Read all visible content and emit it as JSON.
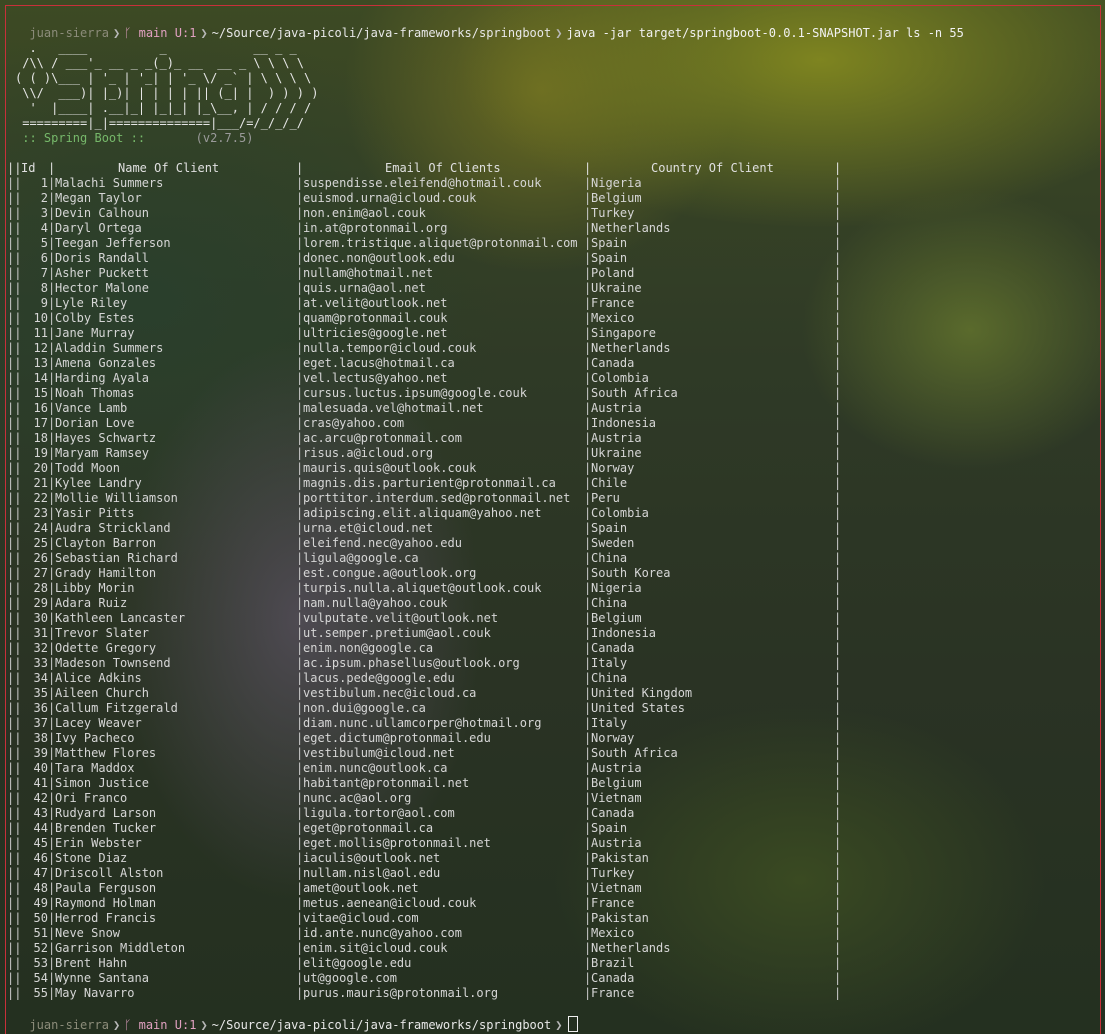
{
  "prompt": {
    "user": "juan-sierra",
    "branch": "main",
    "changes": "U:1",
    "path": "~/Source/java-picoli/java-frameworks/springboot"
  },
  "command": "java -jar target/springboot-0.0.1-SNAPSHOT.jar ls -n 55",
  "banner": {
    "ascii": [
      "  .   ____          _            __ _ _",
      " /\\\\ / ___'_ __ _ _(_)_ __  __ _ \\ \\ \\ \\",
      "( ( )\\___ | '_ | '_| | '_ \\/ _` | \\ \\ \\ \\",
      " \\\\/  ___)| |_)| | | | | || (_| |  ) ) ) )",
      "  '  |____| .__|_| |_|_| |_\\__, | / / / /",
      " =========|_|==============|___/=/_/_/_/"
    ],
    "spring_label": " :: Spring Boot ::",
    "spring_version": "(v2.7.5)"
  },
  "table": {
    "headers": [
      "Id",
      "Name Of Client",
      "Email Of Clients",
      "Country Of Client"
    ],
    "rows": [
      {
        "id": "1",
        "name": "Malachi Summers",
        "email": "suspendisse.eleifend@hotmail.couk",
        "country": "Nigeria"
      },
      {
        "id": "2",
        "name": "Megan Taylor",
        "email": "euismod.urna@icloud.couk",
        "country": "Belgium"
      },
      {
        "id": "3",
        "name": "Devin Calhoun",
        "email": "non.enim@aol.couk",
        "country": "Turkey"
      },
      {
        "id": "4",
        "name": "Daryl Ortega",
        "email": "in.at@protonmail.org",
        "country": "Netherlands"
      },
      {
        "id": "5",
        "name": "Teegan Jefferson",
        "email": "lorem.tristique.aliquet@protonmail.com",
        "country": "Spain"
      },
      {
        "id": "6",
        "name": "Doris Randall",
        "email": "donec.non@outlook.edu",
        "country": "Spain"
      },
      {
        "id": "7",
        "name": "Asher Puckett",
        "email": "nullam@hotmail.net",
        "country": "Poland"
      },
      {
        "id": "8",
        "name": "Hector Malone",
        "email": "quis.urna@aol.net",
        "country": "Ukraine"
      },
      {
        "id": "9",
        "name": "Lyle Riley",
        "email": "at.velit@outlook.net",
        "country": "France"
      },
      {
        "id": "10",
        "name": "Colby Estes",
        "email": "quam@protonmail.couk",
        "country": "Mexico"
      },
      {
        "id": "11",
        "name": "Jane Murray",
        "email": "ultricies@google.net",
        "country": "Singapore"
      },
      {
        "id": "12",
        "name": "Aladdin Summers",
        "email": "nulla.tempor@icloud.couk",
        "country": "Netherlands"
      },
      {
        "id": "13",
        "name": "Amena Gonzales",
        "email": "eget.lacus@hotmail.ca",
        "country": "Canada"
      },
      {
        "id": "14",
        "name": "Harding Ayala",
        "email": "vel.lectus@yahoo.net",
        "country": "Colombia"
      },
      {
        "id": "15",
        "name": "Noah Thomas",
        "email": "cursus.luctus.ipsum@google.couk",
        "country": "South Africa"
      },
      {
        "id": "16",
        "name": "Vance Lamb",
        "email": "malesuada.vel@hotmail.net",
        "country": "Austria"
      },
      {
        "id": "17",
        "name": "Dorian Love",
        "email": "cras@yahoo.com",
        "country": "Indonesia"
      },
      {
        "id": "18",
        "name": "Hayes Schwartz",
        "email": "ac.arcu@protonmail.com",
        "country": "Austria"
      },
      {
        "id": "19",
        "name": "Maryam Ramsey",
        "email": "risus.a@icloud.org",
        "country": "Ukraine"
      },
      {
        "id": "20",
        "name": "Todd Moon",
        "email": "mauris.quis@outlook.couk",
        "country": "Norway"
      },
      {
        "id": "21",
        "name": "Kylee Landry",
        "email": "magnis.dis.parturient@protonmail.ca",
        "country": "Chile"
      },
      {
        "id": "22",
        "name": "Mollie Williamson",
        "email": "porttitor.interdum.sed@protonmail.net",
        "country": "Peru"
      },
      {
        "id": "23",
        "name": "Yasir Pitts",
        "email": "adipiscing.elit.aliquam@yahoo.net",
        "country": "Colombia"
      },
      {
        "id": "24",
        "name": "Audra Strickland",
        "email": "urna.et@icloud.net",
        "country": "Spain"
      },
      {
        "id": "25",
        "name": "Clayton Barron",
        "email": "eleifend.nec@yahoo.edu",
        "country": "Sweden"
      },
      {
        "id": "26",
        "name": "Sebastian Richard",
        "email": "ligula@google.ca",
        "country": "China"
      },
      {
        "id": "27",
        "name": "Grady Hamilton",
        "email": "est.congue.a@outlook.org",
        "country": "South Korea"
      },
      {
        "id": "28",
        "name": "Libby Morin",
        "email": "turpis.nulla.aliquet@outlook.couk",
        "country": "Nigeria"
      },
      {
        "id": "29",
        "name": "Adara Ruiz",
        "email": "nam.nulla@yahoo.couk",
        "country": "China"
      },
      {
        "id": "30",
        "name": "Kathleen Lancaster",
        "email": "vulputate.velit@outlook.net",
        "country": "Belgium"
      },
      {
        "id": "31",
        "name": "Trevor Slater",
        "email": "ut.semper.pretium@aol.couk",
        "country": "Indonesia"
      },
      {
        "id": "32",
        "name": "Odette Gregory",
        "email": "enim.non@google.ca",
        "country": "Canada"
      },
      {
        "id": "33",
        "name": "Madeson Townsend",
        "email": "ac.ipsum.phasellus@outlook.org",
        "country": "Italy"
      },
      {
        "id": "34",
        "name": "Alice Adkins",
        "email": "lacus.pede@google.edu",
        "country": "China"
      },
      {
        "id": "35",
        "name": "Aileen Church",
        "email": "vestibulum.nec@icloud.ca",
        "country": "United Kingdom"
      },
      {
        "id": "36",
        "name": "Callum Fitzgerald",
        "email": "non.dui@google.ca",
        "country": "United States"
      },
      {
        "id": "37",
        "name": "Lacey Weaver",
        "email": "diam.nunc.ullamcorper@hotmail.org",
        "country": "Italy"
      },
      {
        "id": "38",
        "name": "Ivy Pacheco",
        "email": "eget.dictum@protonmail.edu",
        "country": "Norway"
      },
      {
        "id": "39",
        "name": "Matthew Flores",
        "email": "vestibulum@icloud.net",
        "country": "South Africa"
      },
      {
        "id": "40",
        "name": "Tara Maddox",
        "email": "enim.nunc@outlook.ca",
        "country": "Austria"
      },
      {
        "id": "41",
        "name": "Simon Justice",
        "email": "habitant@protonmail.net",
        "country": "Belgium"
      },
      {
        "id": "42",
        "name": "Ori Franco",
        "email": "nunc.ac@aol.org",
        "country": "Vietnam"
      },
      {
        "id": "43",
        "name": "Rudyard Larson",
        "email": "ligula.tortor@aol.com",
        "country": "Canada"
      },
      {
        "id": "44",
        "name": "Brenden Tucker",
        "email": "eget@protonmail.ca",
        "country": "Spain"
      },
      {
        "id": "45",
        "name": "Erin Webster",
        "email": "eget.mollis@protonmail.net",
        "country": "Austria"
      },
      {
        "id": "46",
        "name": "Stone Diaz",
        "email": "iaculis@outlook.net",
        "country": "Pakistan"
      },
      {
        "id": "47",
        "name": "Driscoll Alston",
        "email": "nullam.nisl@aol.edu",
        "country": "Turkey"
      },
      {
        "id": "48",
        "name": "Paula Ferguson",
        "email": "amet@outlook.net",
        "country": "Vietnam"
      },
      {
        "id": "49",
        "name": "Raymond Holman",
        "email": "metus.aenean@icloud.couk",
        "country": "France"
      },
      {
        "id": "50",
        "name": "Herrod Francis",
        "email": "vitae@icloud.com",
        "country": "Pakistan"
      },
      {
        "id": "51",
        "name": "Neve Snow",
        "email": "id.ante.nunc@yahoo.com",
        "country": "Mexico"
      },
      {
        "id": "52",
        "name": "Garrison Middleton",
        "email": "enim.sit@icloud.couk",
        "country": "Netherlands"
      },
      {
        "id": "53",
        "name": "Brent Hahn",
        "email": "elit@google.edu",
        "country": "Brazil"
      },
      {
        "id": "54",
        "name": "Wynne Santana",
        "email": "ut@google.com",
        "country": "Canada"
      },
      {
        "id": "55",
        "name": "May Navarro",
        "email": "purus.mauris@protonmail.org",
        "country": "France"
      }
    ]
  },
  "colors": {
    "window_border": "#c8303a",
    "git_branch": "#e0a0c0",
    "spring_label": "#76b86a"
  },
  "icons": {
    "prompt_separator": "chevron-right-icon",
    "git_branch": "git-branch-icon"
  }
}
